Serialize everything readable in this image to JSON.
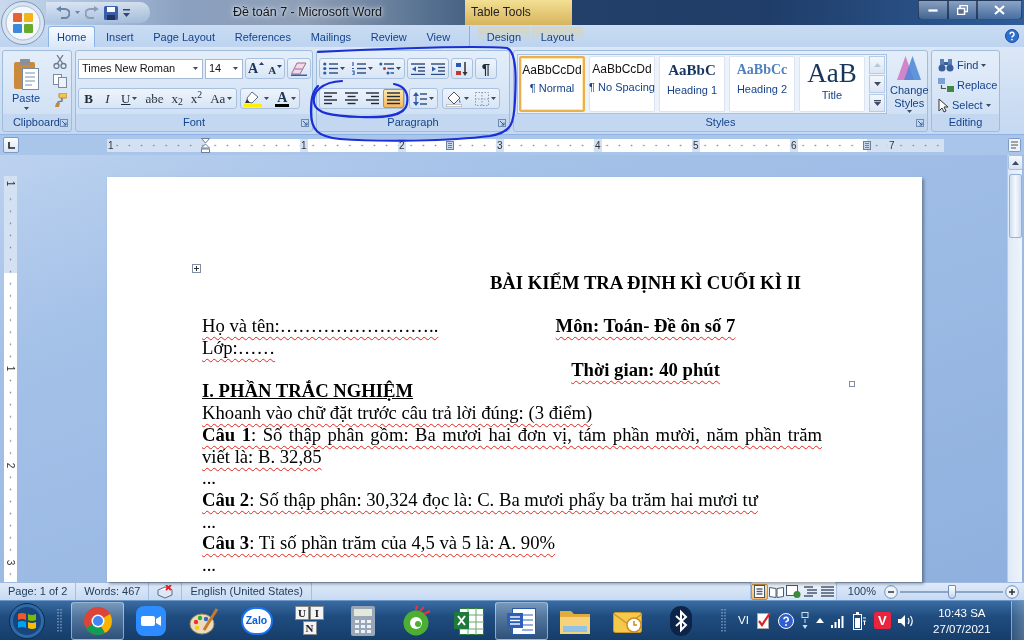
{
  "window": {
    "title": "Đề toán 7 - Microsoft Word",
    "context_group": "Table Tools"
  },
  "tabs": [
    {
      "label": "Home",
      "selected": true,
      "contextual": false
    },
    {
      "label": "Insert",
      "selected": false,
      "contextual": false
    },
    {
      "label": "Page Layout",
      "selected": false,
      "contextual": false
    },
    {
      "label": "References",
      "selected": false,
      "contextual": false
    },
    {
      "label": "Mailings",
      "selected": false,
      "contextual": false
    },
    {
      "label": "Review",
      "selected": false,
      "contextual": false
    },
    {
      "label": "View",
      "selected": false,
      "contextual": false
    },
    {
      "label": "Design",
      "selected": false,
      "contextual": true
    },
    {
      "label": "Layout",
      "selected": false,
      "contextual": true
    }
  ],
  "clipboard": {
    "paste": "Paste",
    "label": "Clipboard"
  },
  "font": {
    "name": "Times New Roman",
    "size": "14",
    "size_buttons": [
      {
        "label": "A",
        "kind": "grow"
      },
      {
        "label": "A",
        "kind": "shrink"
      }
    ],
    "format_buttons": [
      {
        "label": "B",
        "kind": "bold",
        "dropdown": false
      },
      {
        "label": "I",
        "kind": "italic",
        "dropdown": false
      },
      {
        "label": "U",
        "kind": "underline",
        "dropdown": true
      },
      {
        "label": "abe",
        "kind": "strike",
        "dropdown": false
      },
      {
        "label": "x$_{2}$",
        "kind": "plain",
        "dropdown": false
      },
      {
        "label": "x$^{2}$",
        "kind": "plain",
        "dropdown": false
      },
      {
        "label": "Aa",
        "kind": "plain",
        "dropdown": true
      }
    ],
    "font_color": "A",
    "label": "Font"
  },
  "paragraph": {
    "show_marks": "¶",
    "alignments": [
      {
        "kind": "left",
        "selected": false
      },
      {
        "kind": "center",
        "selected": false
      },
      {
        "kind": "right",
        "selected": false
      },
      {
        "kind": "justify",
        "selected": true
      }
    ],
    "label": "Paragraph"
  },
  "styles": {
    "items": [
      {
        "preview": "AaBbCcDd",
        "name": "¶ Normal",
        "kind": "body",
        "selected": true
      },
      {
        "preview": "AaBbCcDd",
        "name": "¶ No Spacing",
        "kind": "body",
        "selected": false
      },
      {
        "preview": "AaBbC",
        "name": "Heading 1",
        "kind": "heading1",
        "selected": false
      },
      {
        "preview": "AaBbCc",
        "name": "Heading 2",
        "kind": "heading2",
        "selected": false
      },
      {
        "preview": "AaB",
        "name": "Title",
        "kind": "title",
        "selected": false
      }
    ],
    "change_styles": "Change Styles",
    "label": "Styles"
  },
  "editing": {
    "items": [
      {
        "label": "Find",
        "kind": "find",
        "dropdown": true
      },
      {
        "label": "Replace",
        "kind": "replace",
        "dropdown": false
      },
      {
        "label": "Select",
        "kind": "select",
        "dropdown": true
      }
    ],
    "label": "Editing"
  },
  "ruler": {
    "labels": [
      "1",
      "1",
      "2",
      "3",
      "4",
      "5",
      "6",
      "7"
    ]
  },
  "vertical_ruler": {
    "labels": [
      "1",
      "1",
      "2",
      "3"
    ]
  },
  "document": {
    "left_cell": [
      {
        "text": "Họ và tên:……………………..",
        "flagged": true
      },
      {
        "text": "Lớp:……",
        "flagged": true
      }
    ],
    "right_cell": [
      {
        "text": "BÀI KIỂM TRA ĐỊNH KÌ CUỐI KÌ II",
        "flagged": false
      },
      {
        "text": "Môn: Toán- Đề ôn số 7",
        "flagged": true
      },
      {
        "text": "Thời gian: 40 phút",
        "flagged": true
      }
    ],
    "paragraphs": [
      {
        "text": "I. PHẦN TRẮC NGHIỆM",
        "kind": "heading",
        "flagged": false
      },
      {
        "text": "Khoanh vào chữ đặt trước câu trả lời đúng: (3 điểm)",
        "kind": "body",
        "flagged": true
      },
      {
        "text": "**Câu 1**: Số thập phân gồm: Ba mươi hai đơn vị, tám phần mười, năm phần trăm viết là: B. 32,85",
        "kind": "body",
        "flagged": true
      },
      {
        "text": "...",
        "kind": "body",
        "flagged": false
      },
      {
        "text": "**Câu 2**: Số thập phân: 30,324 đọc là: C. Ba mươi phẩy ba trăm hai mươi tư",
        "kind": "body",
        "flagged": true
      },
      {
        "text": "...",
        "kind": "body",
        "flagged": false
      },
      {
        "text": "**Câu 3**: Tỉ số phần trăm của 4,5 và 5 là: A. 90%",
        "kind": "body",
        "flagged": true
      },
      {
        "text": "...",
        "kind": "body",
        "flagged": false
      }
    ]
  },
  "status_bar": {
    "page": "Page: 1 of 2",
    "words": "Words: 467",
    "language": "English (United States)",
    "views": [
      {
        "kind": "print",
        "selected": true
      },
      {
        "kind": "reading",
        "selected": false
      },
      {
        "kind": "web",
        "selected": false
      },
      {
        "kind": "outline",
        "selected": false
      },
      {
        "kind": "draft",
        "selected": false
      }
    ],
    "zoom": {
      "reading": "100%",
      "level": 0.5
    }
  },
  "taskbar": {
    "apps": [
      {
        "kind": "browser",
        "running": true
      },
      {
        "kind": "video",
        "running": false
      },
      {
        "kind": "paint",
        "running": false
      },
      {
        "kind": "chat",
        "label": "Zalo",
        "running": false
      },
      {
        "kind": "letters",
        "letters": [
          "U",
          "I",
          "N"
        ],
        "running": false
      },
      {
        "kind": "calculator",
        "running": false
      },
      {
        "kind": "circle",
        "running": false
      },
      {
        "kind": "spreadsheet",
        "running": false
      },
      {
        "kind": "document",
        "running": true
      },
      {
        "kind": "folder",
        "running": false
      },
      {
        "kind": "mail",
        "running": false
      },
      {
        "kind": "bluetooth",
        "running": false
      }
    ],
    "language": "VI",
    "tray_badge": "V",
    "time": "10:43 SA",
    "date": "27/07/2021"
  }
}
